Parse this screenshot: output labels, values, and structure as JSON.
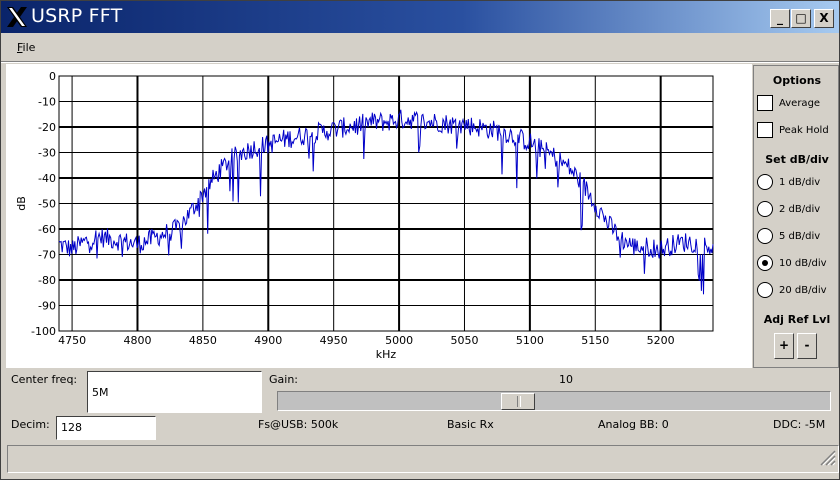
{
  "window": {
    "title": "USRP FFT",
    "minimize": "_",
    "maximize": "□",
    "close": "X"
  },
  "menu": {
    "file_mnemonic": "F",
    "file_rest": "ile"
  },
  "chart_data": {
    "type": "line",
    "xlabel": "kHz",
    "ylabel": "dB",
    "xlim": [
      4740,
      5240
    ],
    "ylim": [
      -100,
      0
    ],
    "x_ticks": [
      "4750",
      "4800",
      "4850",
      "4900",
      "4950",
      "5000",
      "5050",
      "5100",
      "5150",
      "5200"
    ],
    "y_ticks": [
      "0",
      "-10",
      "-20",
      "-30",
      "-40",
      "-50",
      "-60",
      "-70",
      "-80",
      "-90",
      "-100"
    ],
    "grid": true,
    "line_color": "#0000c8",
    "envelope": {
      "x": [
        4740,
        4750,
        4760,
        4770,
        4780,
        4790,
        4800,
        4810,
        4820,
        4830,
        4840,
        4850,
        4860,
        4870,
        4880,
        4890,
        4900,
        4910,
        4920,
        4930,
        4940,
        4950,
        4960,
        4970,
        4980,
        4990,
        5000,
        5010,
        5020,
        5030,
        5040,
        5050,
        5060,
        5070,
        5080,
        5090,
        5100,
        5110,
        5120,
        5130,
        5140,
        5150,
        5160,
        5170,
        5180,
        5190,
        5200,
        5210,
        5220,
        5230,
        5240
      ],
      "y": [
        -66,
        -68,
        -65,
        -63,
        -64,
        -65,
        -66,
        -64,
        -62,
        -60,
        -54,
        -46,
        -39,
        -33,
        -30,
        -28,
        -27,
        -25,
        -24,
        -23,
        -22,
        -21,
        -20,
        -19,
        -18,
        -18,
        -17,
        -17,
        -18,
        -18,
        -19,
        -19,
        -20,
        -21,
        -22,
        -24,
        -26,
        -29,
        -32,
        -36,
        -42,
        -50,
        -58,
        -64,
        -67,
        -67,
        -68,
        -66,
        -65,
        -66,
        -67
      ]
    },
    "noise_amplitude_db": 4,
    "dropout_depth_db": 18
  },
  "options": {
    "title": "Options",
    "average": "Average",
    "peak_hold": "Peak Hold",
    "set_title": "Set dB/div",
    "radios": [
      {
        "label": "1 dB/div",
        "selected": false
      },
      {
        "label": "2 dB/div",
        "selected": false
      },
      {
        "label": "5 dB/div",
        "selected": false
      },
      {
        "label": "10 dB/div",
        "selected": true
      },
      {
        "label": "20 dB/div",
        "selected": false
      }
    ],
    "adj_title": "Adj Ref Lvl",
    "plus": "+",
    "minus": "-"
  },
  "controls": {
    "center_freq_label": "Center freq:",
    "center_freq_value": "5M",
    "gain_label": "Gain:",
    "gain_value": "10",
    "gain_fraction": 0.43,
    "decim_label": "Decim:",
    "decim_value": "128",
    "fs_usb": "Fs@USB: 500k",
    "mode": "Basic Rx",
    "analog_bb": "Analog BB: 0",
    "ddc": "DDC: -5M"
  }
}
